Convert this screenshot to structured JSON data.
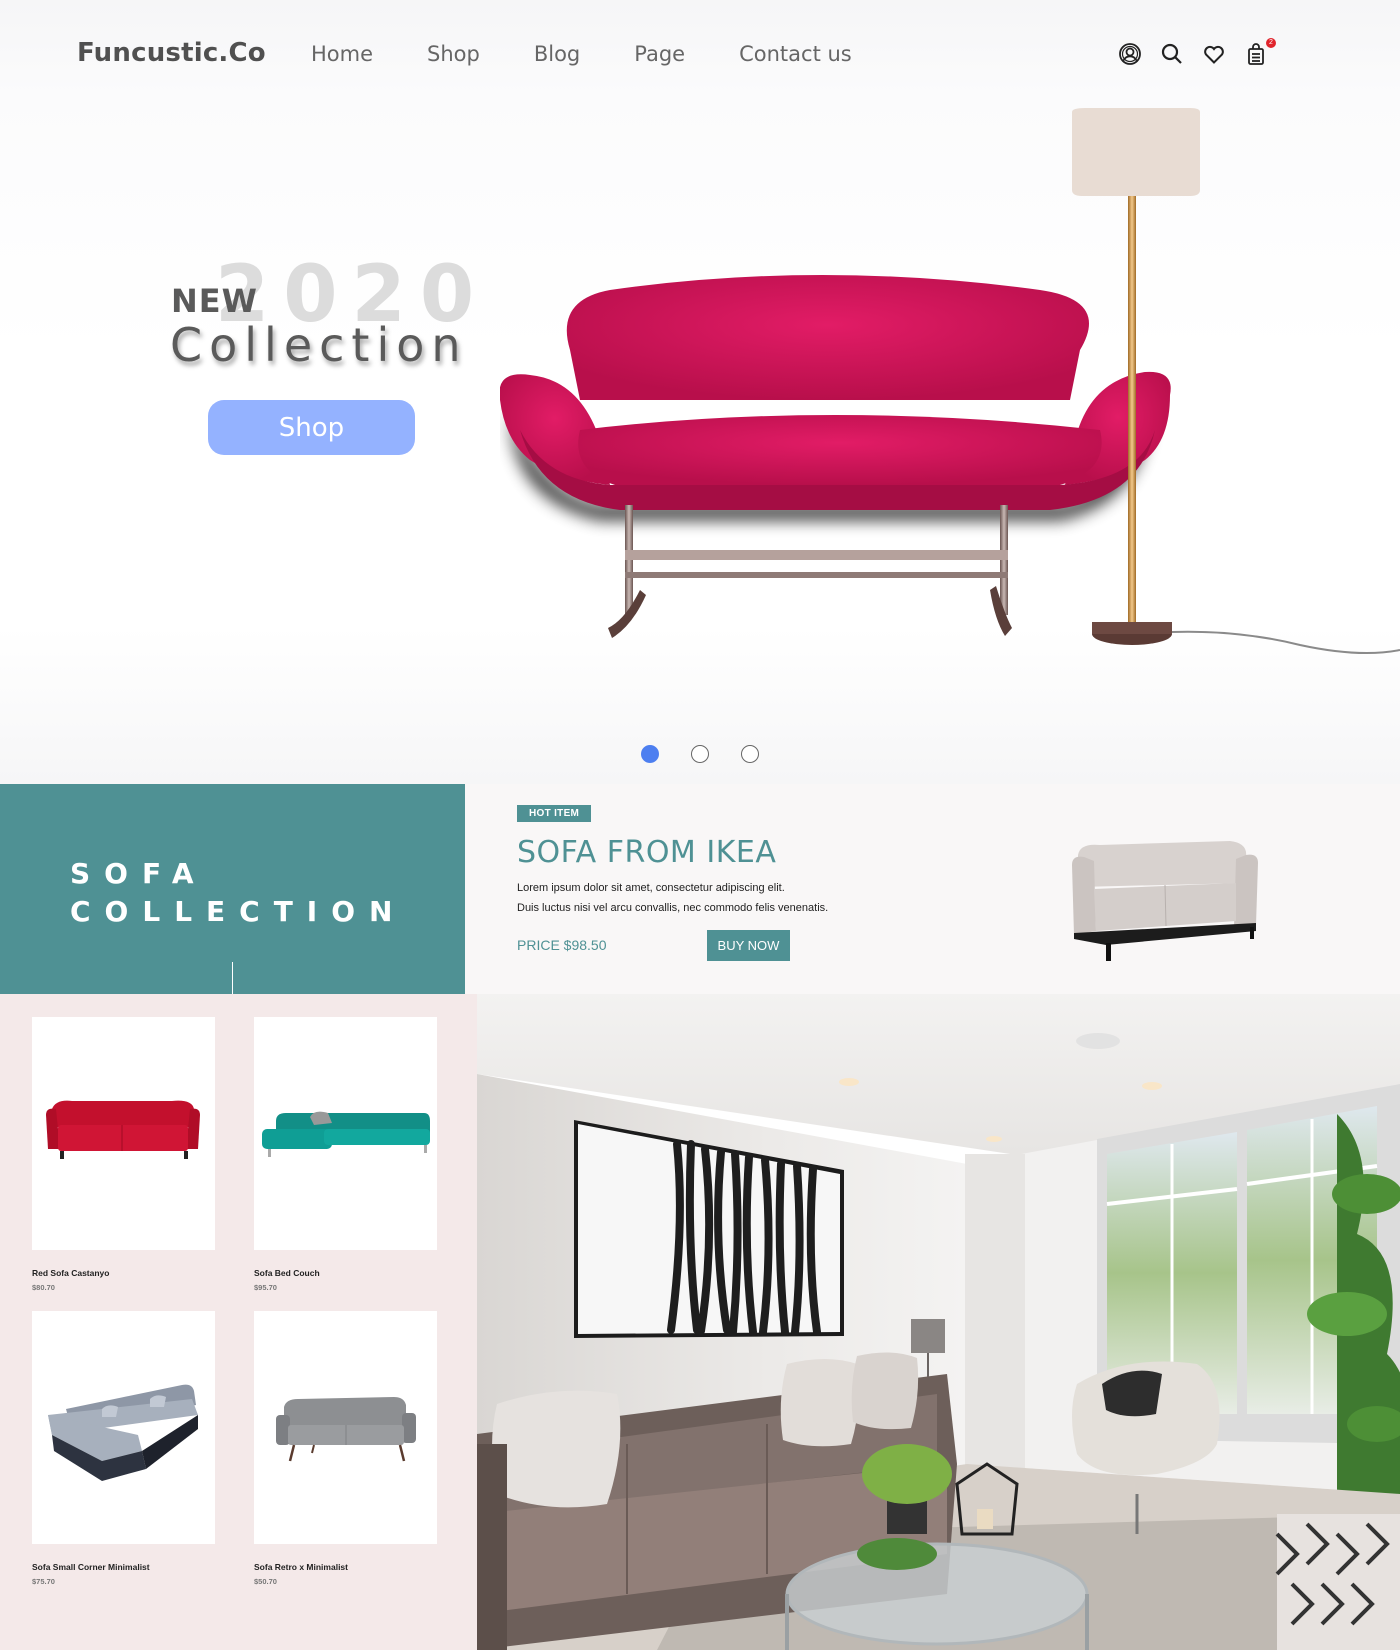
{
  "brand": "Funcustic.Co",
  "nav": [
    "Home",
    "Shop",
    "Blog",
    "Page",
    "Contact us"
  ],
  "header_icons": [
    "account-icon",
    "search-icon",
    "heart-icon",
    "shopping-bag-icon"
  ],
  "cart_count": "2",
  "hero": {
    "year": "2020",
    "new_label": "NEW",
    "collection_label": "Collection",
    "shop_button": "Shop",
    "carousel_active_index": 0,
    "carousel_count": 3
  },
  "sofa_band": {
    "title_line1": "SOFA",
    "title_line2": "COLLECTION",
    "badge": "HOT ITEM",
    "product_title": "SOFA FROM IKEA",
    "desc_line1": "Lorem ipsum dolor sit amet, consectetur adipiscing elit.",
    "desc_line2": "Duis luctus nisi vel arcu convallis, nec commodo felis venenatis.",
    "price": "PRICE $98.50",
    "buy_button": "BUY NOW"
  },
  "products": [
    {
      "name": "Red Sofa Castanyo",
      "price": "$80.70"
    },
    {
      "name": "Sofa Bed Couch",
      "price": "$95.70"
    },
    {
      "name": "Sofa Small Corner Minimalist",
      "price": "$75.70"
    },
    {
      "name": "Sofa Retro x Minimalist",
      "price": "$50.70"
    }
  ],
  "colors": {
    "accent_teal": "#4f9194",
    "shop_button": "#94b2ff",
    "carousel_active": "#4d7ff0",
    "hero_sofa": "#d4145a",
    "cart_badge": "#e0242c",
    "grid_background": "#f4e9e9"
  }
}
